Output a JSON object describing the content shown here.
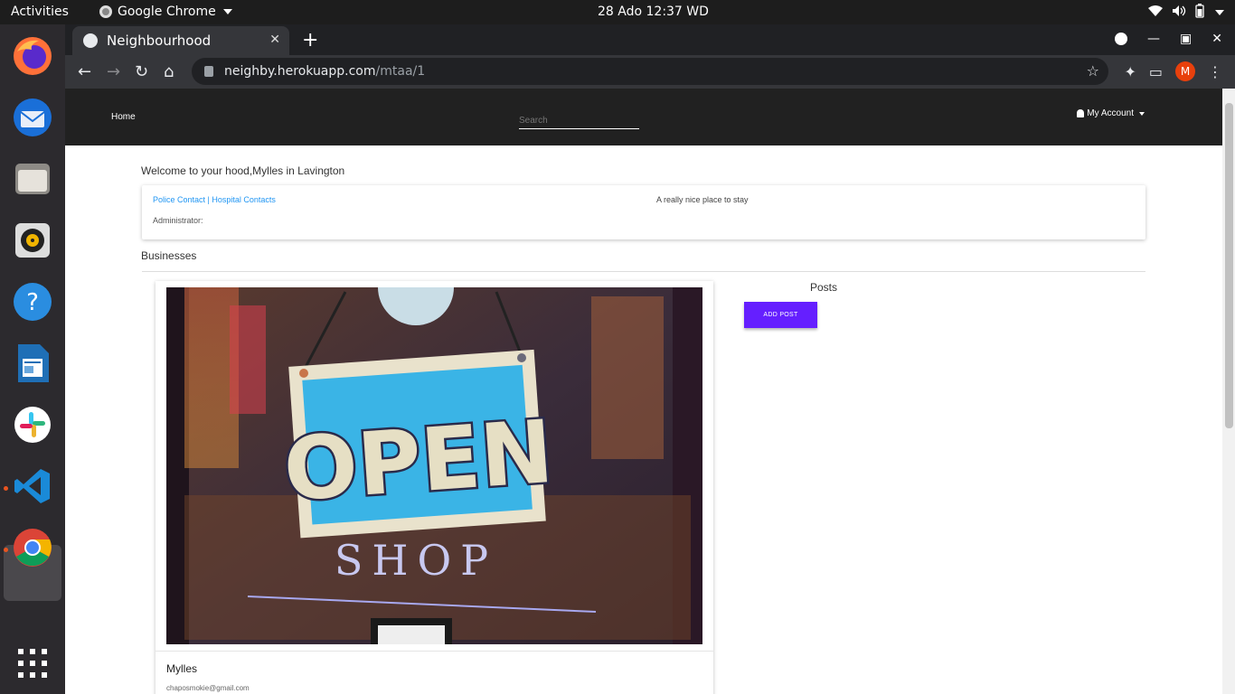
{
  "system": {
    "activities": "Activities",
    "app_name": "Google Chrome",
    "clock": "28 Ado  12:37 WD"
  },
  "dock": {
    "apps": [
      "firefox-icon",
      "thunderbird-icon",
      "files-icon",
      "rhythmbox-icon",
      "help-icon",
      "libreoffice-writer-icon",
      "slack-icon",
      "vscode-icon",
      "chrome-icon",
      "app-grid-icon"
    ]
  },
  "browser": {
    "tab_title": "Neighbourhood",
    "url_host": "neighby.herokuapp.com",
    "url_path": "/mtaa/1",
    "profile_initial": "M"
  },
  "site": {
    "nav": {
      "home": "Home",
      "search_placeholder": "Search",
      "account": "My Account"
    },
    "welcome": "Welcome to your hood,Mylles in Lavington",
    "info": {
      "police": "Police Contact",
      "separator": " | ",
      "hospital": "Hospital Contacts",
      "description": "A really nice place to stay",
      "admin": "Administrator:"
    },
    "businesses_heading": "Businesses",
    "business": {
      "image_text": "OPEN",
      "image_subtext": "SHOP",
      "name": "Mylles",
      "email": "chaposmokie@gmail.com"
    },
    "posts_heading": "Posts",
    "add_post": "ADD POST"
  },
  "colors": {
    "nav_bg": "#212121",
    "accent": "#651fff",
    "link": "#2196f3"
  }
}
